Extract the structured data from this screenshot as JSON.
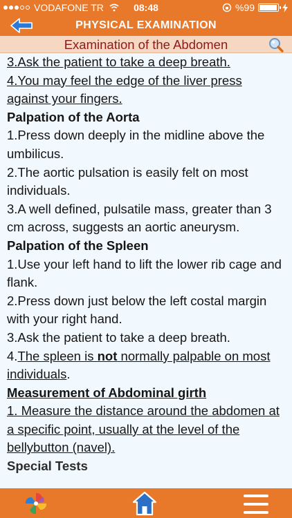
{
  "status_bar": {
    "carrier": "VODAFONE TR",
    "time": "08:48",
    "battery": "%99",
    "signal_strength": 3
  },
  "header": {
    "title": "PHYSICAL EXAMINATION"
  },
  "section": {
    "title": "Examination of the Abdomen"
  },
  "content": {
    "liver_step3": "3.Ask the patient to take a deep breath.",
    "liver_step4": "4.You may feel the edge of the liver press against your fingers.",
    "aorta_heading": "Palpation of the Aorta",
    "aorta_step1": "1.Press down deeply in the midline above the umbilicus.",
    "aorta_step2": "2.The aortic pulsation is easily felt on most individuals.",
    "aorta_step3": "3.A well defined, pulsatile mass, greater than 3 cm across, suggests an aortic aneurysm.",
    "spleen_heading": "Palpation of the Spleen",
    "spleen_step1": "1.Use your left hand to lift the lower rib cage and flank.",
    "spleen_step2": "2.Press down just below the left costal margin with your right hand.",
    "spleen_step3": "3.Ask the patient to take a deep breath.",
    "spleen_step4_prefix": "4.",
    "spleen_step4_a": "The spleen is ",
    "spleen_step4_bold": "not",
    "spleen_step4_b": " normally palpable on most individuals",
    "spleen_step4_suffix": ".",
    "girth_heading": "Measurement of Abdominal girth",
    "girth_step1": "1. Measure the distance around the abdomen at a specific point, usually at the level of the bellybutton (navel).",
    "special_heading": "Special Tests"
  },
  "colors": {
    "accent": "#e8782a",
    "section_bg": "#f5d7c2",
    "section_text": "#8c1a1a",
    "content_bg": "#f1f8fe",
    "back_arrow": "#2d7ad6",
    "home_icon": "#2d6fc4"
  },
  "icons": {
    "back": "back-arrow-icon",
    "search": "magnifier-icon",
    "logo": "pinwheel-logo",
    "home": "home-icon",
    "menu": "hamburger-menu-icon"
  }
}
